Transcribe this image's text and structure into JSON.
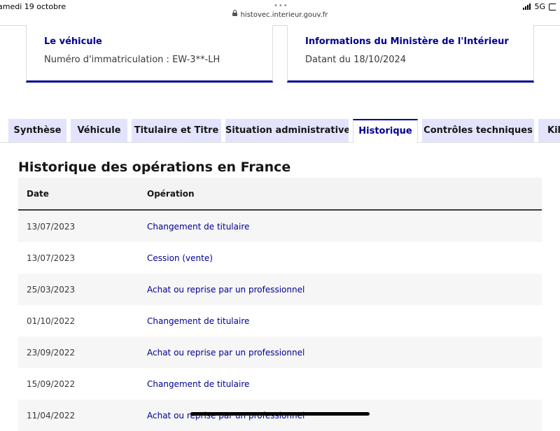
{
  "status_bar": {
    "date": "amedi 19 octobre",
    "url": "histovec.interieur.gouv.fr",
    "network": "5G"
  },
  "vehicle_card": {
    "title": "Le véhicule",
    "plate": "Numéro d'immatriculation : EW-3**-LH"
  },
  "ministry_card": {
    "title": "Informations du Ministère de l'Intérieur",
    "date": "Datant du 18/10/2024"
  },
  "tabs": [
    {
      "label": "Synthèse",
      "active": false
    },
    {
      "label": "Véhicule",
      "active": false
    },
    {
      "label": "Titulaire et Titre",
      "active": false
    },
    {
      "label": "Situation administrative",
      "active": false
    },
    {
      "label": "Historique",
      "active": true
    },
    {
      "label": "Contrôles techniques",
      "active": false
    },
    {
      "label": "Kilométrage",
      "active": false
    }
  ],
  "history": {
    "title": "Historique des opérations en France",
    "columns": {
      "date": "Date",
      "operation": "Opération"
    },
    "rows": [
      {
        "date": "13/07/2023",
        "operation": "Changement de titulaire"
      },
      {
        "date": "13/07/2023",
        "operation": "Cession (vente)"
      },
      {
        "date": "25/03/2023",
        "operation": "Achat ou reprise par un professionnel"
      },
      {
        "date": "01/10/2022",
        "operation": "Changement de titulaire"
      },
      {
        "date": "23/09/2022",
        "operation": "Achat ou reprise par un professionnel"
      },
      {
        "date": "15/09/2022",
        "operation": "Changement de titulaire"
      },
      {
        "date": "11/04/2022",
        "operation": "Achat ou reprise par un professionnel"
      }
    ]
  },
  "colors": {
    "accent": "#000091",
    "tab_bg": "#e3e3fd",
    "row_alt": "#f6f6f6"
  },
  "icons": [
    "lock-icon",
    "signal-icon",
    "battery-icon"
  ]
}
